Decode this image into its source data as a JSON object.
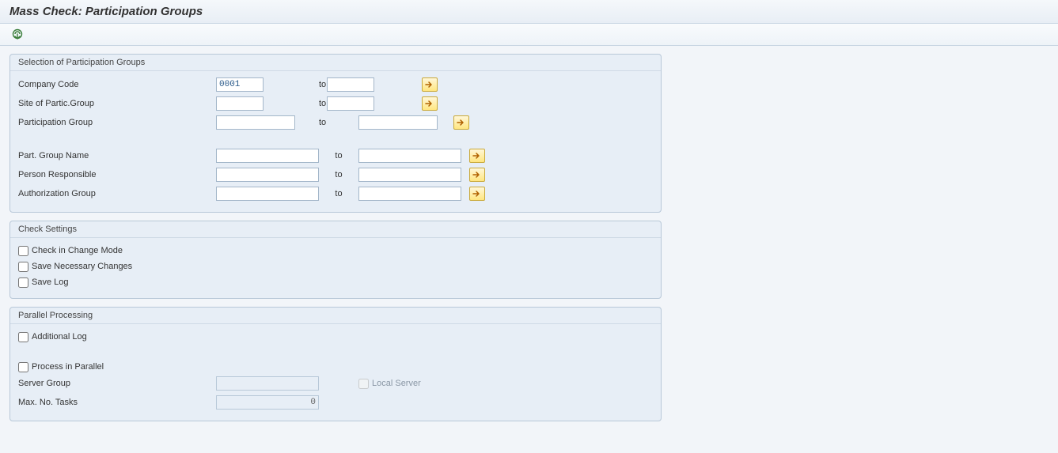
{
  "header": {
    "title": "Mass Check: Participation Groups"
  },
  "toolbar": {
    "execute_icon": "execute-icon"
  },
  "selectionGroup": {
    "title": "Selection of Participation Groups",
    "to_label": "to",
    "rows": {
      "companyCode": {
        "label": "Company Code",
        "from": "0001",
        "to": ""
      },
      "siteParticGroup": {
        "label": "Site of Partic.Group",
        "from": "",
        "to": ""
      },
      "participationGroup": {
        "label": "Participation Group",
        "from": "",
        "to": ""
      },
      "partGroupName": {
        "label": "Part. Group Name",
        "from": "",
        "to": ""
      },
      "personResponsible": {
        "label": "Person Responsible",
        "from": "",
        "to": ""
      },
      "authorizationGroup": {
        "label": "Authorization Group",
        "from": "",
        "to": ""
      }
    }
  },
  "checkSettings": {
    "title": "Check Settings",
    "checkChangeMode": "Check in Change Mode",
    "saveNecessaryChanges": "Save Necessary Changes",
    "saveLog": "Save Log"
  },
  "parallelProcessing": {
    "title": "Parallel Processing",
    "additionalLog": "Additional Log",
    "processInParallel": "Process in Parallel",
    "serverGroup": {
      "label": "Server Group",
      "value": ""
    },
    "localServer": "Local Server",
    "maxNoTasks": {
      "label": "Max. No. Tasks",
      "value": "0"
    }
  }
}
